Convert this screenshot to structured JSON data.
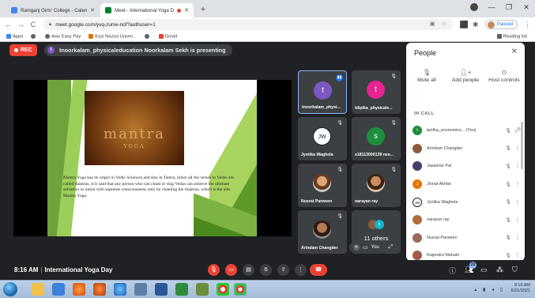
{
  "browser": {
    "tabs": [
      {
        "title": "Raniganj Girls' College - Calendar",
        "close": "✕"
      },
      {
        "title": "Meet - International Yoga D",
        "close": "✕"
      }
    ],
    "url": "meet.google.com/yvq-zunw-nof?authuser=1",
    "profile_status": "Paused",
    "bookmarks": [
      "Apps",
      "Axis Easy Pay",
      "Kazi Nazrul Univer...",
      "Gmail"
    ],
    "reading_list": "Reading list",
    "colors": {
      "chrome_bg": "#dee1e6",
      "accent": "#1a73e8"
    }
  },
  "meeting": {
    "rec_label": "REC",
    "presenting_text": "tnoorkalam_physicaleducation Noorkalam Sekh is presenting",
    "presenter_initial": "t",
    "slide": {
      "image_title": "mantra",
      "image_subtitle": "YOGA",
      "body": "Mantra Yoga has its origin in Vedic Sciences and also in Tantra, infact all the verses in Vedas are called mantras, it is said that any person who can chant or sing Vedas can achieve the ultimate salvation or union with supreme consciousness only by chanting the mantras, which is the aim Mantra Yoga."
    },
    "tiles": [
      {
        "name": "tnoorkalam_physi...",
        "initial": "t",
        "color": "#7b59c2"
      },
      {
        "name": "tdipika_physicale...",
        "initial": "t",
        "color": "#e52592"
      },
      {
        "name": "Jyotika Waghela",
        "initial": "JW",
        "color": "#ffffff"
      },
      {
        "name": "s18113000139 nee...",
        "initial": "s",
        "color": "#1e8e3e"
      },
      {
        "name": "Nusrat Parween",
        "initial": "",
        "color": ""
      },
      {
        "name": "narayan ray",
        "initial": "",
        "color": ""
      },
      {
        "name": "Arindam Changder",
        "initial": "",
        "color": ""
      }
    ],
    "others_label": "11 others",
    "you_label": "You",
    "time": "8:16 AM",
    "meeting_name": "International Yoga Day",
    "participant_count": "20"
  },
  "people_panel": {
    "title": "People",
    "actions": [
      {
        "label": "Mute all",
        "icon": "mute-all-icon"
      },
      {
        "label": "Add people",
        "icon": "add-person-icon"
      },
      {
        "label": "Host controls",
        "icon": "host-controls-icon"
      }
    ],
    "in_call_label": "IN CALL",
    "participants": [
      {
        "name": "tpritha_economics...",
        "suffix": "(You)",
        "initial": "t",
        "color": "#1e8e3e"
      },
      {
        "name": "Arindam Changder",
        "suffix": "",
        "initial": "",
        "color": "#8d5a3b"
      },
      {
        "name": "Jayasree Pal",
        "suffix": "",
        "initial": "",
        "color": "#4a3b6b"
      },
      {
        "name": "Jinnat Akhtar",
        "suffix": "",
        "initial": "J",
        "color": "#e37400"
      },
      {
        "name": "Jyotika Waghela",
        "suffix": "",
        "initial": "JW",
        "color": "#ffffff"
      },
      {
        "name": "narayan ray",
        "suffix": "",
        "initial": "",
        "color": "#b26b3a"
      },
      {
        "name": "Nusrat Parween",
        "suffix": "",
        "initial": "",
        "color": "#9b6a5a"
      },
      {
        "name": "Rajendra Mahato",
        "suffix": "",
        "initial": "",
        "color": "#a05a4a"
      }
    ]
  },
  "taskbar": {
    "time": "8:16 AM",
    "date": "6/21/2021"
  }
}
